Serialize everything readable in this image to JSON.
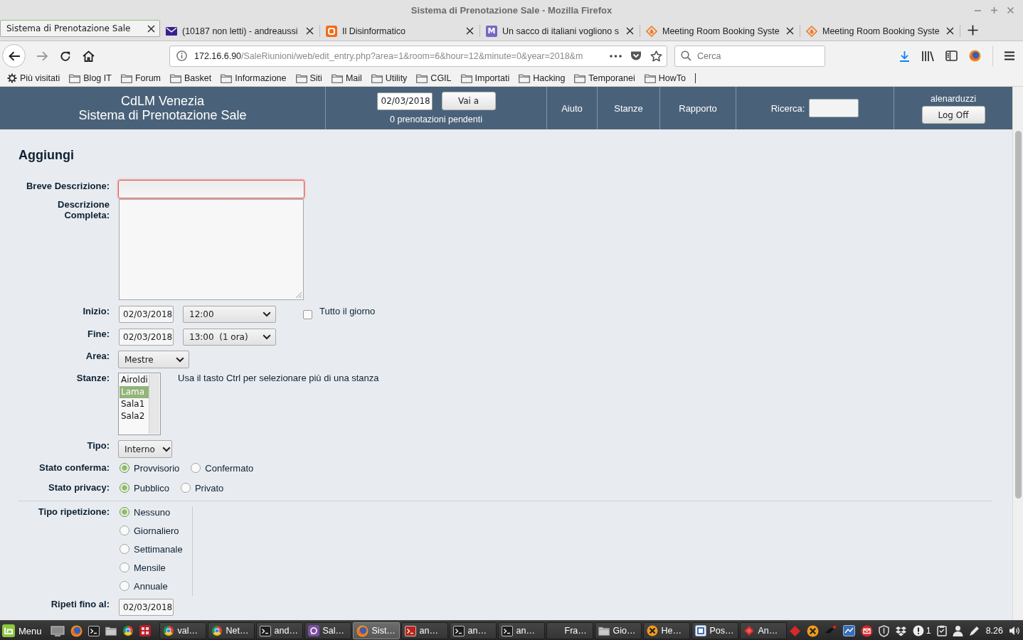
{
  "window": {
    "title": "Sistema di Prenotazione Sale - Mozilla Firefox"
  },
  "tabs": [
    {
      "title": "Sistema di Prenotazione Sale",
      "kind": "plain",
      "selected": true
    },
    {
      "title": "(10187 non letti) - andreaussi",
      "kind": "mail",
      "selected": false
    },
    {
      "title": "Il Disinformatico",
      "kind": "blog",
      "selected": false
    },
    {
      "title": "Un sacco di italiani vogliono s",
      "kind": "letter",
      "icon_letter": "M",
      "selected": false
    },
    {
      "title": "Meeting Room Booking Syste",
      "kind": "booking",
      "selected": false
    },
    {
      "title": "Meeting Room Booking Syste",
      "kind": "booking",
      "selected": false
    }
  ],
  "navbar": {
    "url_host": "172.16.6.90",
    "url_path": "/SaleRiunioni/web/edit_entry.php?area=1&room=6&hour=12&minute=0&year=2018&m",
    "search_placeholder": "Cerca"
  },
  "bookmarks": [
    {
      "label": "Più visitati",
      "kind": "smart"
    },
    {
      "label": "Blog IT",
      "kind": "folder"
    },
    {
      "label": "Forum",
      "kind": "folder"
    },
    {
      "label": "Basket",
      "kind": "folder"
    },
    {
      "label": "Informazione",
      "kind": "folder"
    },
    {
      "label": "Siti",
      "kind": "folder"
    },
    {
      "label": "Mail",
      "kind": "folder"
    },
    {
      "label": "Utility",
      "kind": "folder"
    },
    {
      "label": "CGIL",
      "kind": "folder"
    },
    {
      "label": "Importati",
      "kind": "folder"
    },
    {
      "label": "Hacking",
      "kind": "folder"
    },
    {
      "label": "Temporanei",
      "kind": "folder"
    },
    {
      "label": "HowTo",
      "kind": "folder"
    }
  ],
  "header": {
    "org": "CdLM Venezia",
    "system": "Sistema di Prenotazione Sale",
    "date": "02/03/2018",
    "goto_button": "Vai a",
    "pending": "0 prenotazioni pendenti",
    "nav": [
      "Aiuto",
      "Stanze",
      "Rapporto"
    ],
    "search_label": "Ricerca:",
    "user": "alenarduzzi",
    "logout_button": "Log Off"
  },
  "form": {
    "heading": "Aggiungi",
    "short_description": {
      "label": "Breve Descrizione:",
      "invalid": true
    },
    "full_description": {
      "label": "Descrizione Completa:"
    },
    "start": {
      "label": "Inizio:",
      "date": "02/03/2018",
      "time": "12:00",
      "all_day": {
        "label": "Tutto il giorno",
        "checked": false
      }
    },
    "end": {
      "label": "Fine:",
      "date": "02/03/2018",
      "time": "13:00  (1 ora)"
    },
    "area": {
      "label": "Area:",
      "value": "Mestre"
    },
    "rooms": {
      "label": "Stanze:",
      "options": [
        {
          "label": "Airoldi",
          "selected": false
        },
        {
          "label": "Lama",
          "selected": true
        },
        {
          "label": "Sala1",
          "selected": false
        },
        {
          "label": "Sala2",
          "selected": false
        }
      ],
      "hint": "Usa il tasto Ctrl per selezionare più di una stanza"
    },
    "type": {
      "label": "Tipo:",
      "value": "Interno"
    },
    "confirmation": {
      "label": "Stato conferma:",
      "options": [
        {
          "label": "Provvisorio",
          "selected": true
        },
        {
          "label": "Confermato",
          "selected": false
        }
      ]
    },
    "privacy": {
      "label": "Stato privacy:",
      "options": [
        {
          "label": "Pubblico",
          "selected": true
        },
        {
          "label": "Privato",
          "selected": false
        }
      ]
    },
    "repeat": {
      "label": "Tipo ripetizione:",
      "options": [
        {
          "label": "Nessuno",
          "selected": true
        },
        {
          "label": "Giornaliero",
          "selected": false
        },
        {
          "label": "Settimanale",
          "selected": false
        },
        {
          "label": "Mensile",
          "selected": false
        },
        {
          "label": "Annuale",
          "selected": false
        }
      ]
    },
    "repeat_until": {
      "label": "Ripeti fino al:",
      "date": "02/03/2018"
    }
  },
  "taskbar": {
    "menu": "Menu",
    "windows": [
      {
        "label": "val…",
        "kind": "chrome",
        "selected": false
      },
      {
        "label": "Net…",
        "kind": "chrome",
        "selected": false
      },
      {
        "label": "and…",
        "kind": "terminal",
        "selected": false
      },
      {
        "label": "Sal…",
        "kind": "chat",
        "selected": false
      },
      {
        "label": "Sist…",
        "kind": "firefox",
        "selected": true
      },
      {
        "label": "an…",
        "kind": "terminal-red",
        "selected": false
      },
      {
        "label": "an…",
        "kind": "terminal",
        "selected": false
      },
      {
        "label": "an…",
        "kind": "terminal",
        "selected": false
      },
      {
        "label": "Fra…",
        "kind": "none",
        "selected": false
      },
      {
        "label": "Gio…",
        "kind": "folder",
        "selected": false
      },
      {
        "label": "He…",
        "kind": "cross",
        "selected": false
      },
      {
        "label": "Pos…",
        "kind": "document",
        "selected": false
      },
      {
        "label": "An…",
        "kind": "diamond",
        "selected": false
      }
    ],
    "notification_count": "1",
    "clock": "8.26"
  }
}
